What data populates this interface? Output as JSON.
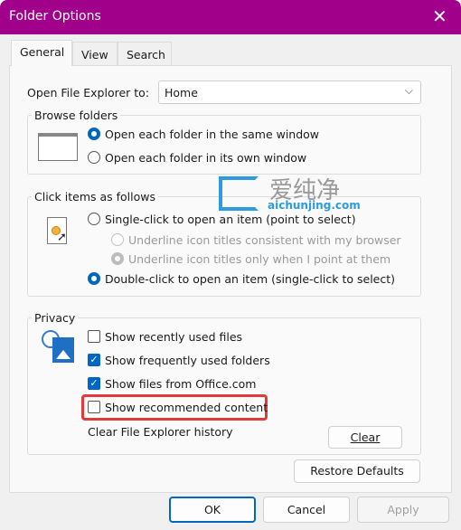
{
  "window": {
    "title": "Folder Options",
    "accent_color": "#a0008a"
  },
  "tabs": [
    {
      "label": "General",
      "selected": true
    },
    {
      "label": "View",
      "selected": false
    },
    {
      "label": "Search",
      "selected": false
    }
  ],
  "open_explorer": {
    "label": "Open File Explorer to:",
    "value": "Home"
  },
  "browse_folders": {
    "title": "Browse folders",
    "options": [
      {
        "label": "Open each folder in the same window",
        "selected": true
      },
      {
        "label": "Open each folder in its own window",
        "selected": false
      }
    ]
  },
  "click_items": {
    "title": "Click items as follows",
    "options": [
      {
        "label": "Single-click to open an item (point to select)",
        "selected": false,
        "enabled": true
      },
      {
        "label": "Underline icon titles consistent with my browser",
        "selected": false,
        "enabled": false
      },
      {
        "label": "Underline icon titles only when I point at them",
        "selected": true,
        "enabled": false
      },
      {
        "label": "Double-click to open an item (single-click to select)",
        "selected": true,
        "enabled": true
      }
    ]
  },
  "privacy": {
    "title": "Privacy",
    "checkboxes": [
      {
        "label": "Show recently used files",
        "checked": false
      },
      {
        "label": "Show frequently used folders",
        "checked": true
      },
      {
        "label": "Show files from Office.com",
        "checked": true
      },
      {
        "label": "Show recommended content",
        "checked": false,
        "highlighted": true
      }
    ],
    "clear_label": "Clear File Explorer history",
    "clear_button": "Clear"
  },
  "restore_defaults": "Restore Defaults",
  "footer": {
    "ok": "OK",
    "cancel": "Cancel",
    "apply": "Apply"
  },
  "watermark": {
    "cn": "爱纯净",
    "url": "aichunjing.com"
  }
}
